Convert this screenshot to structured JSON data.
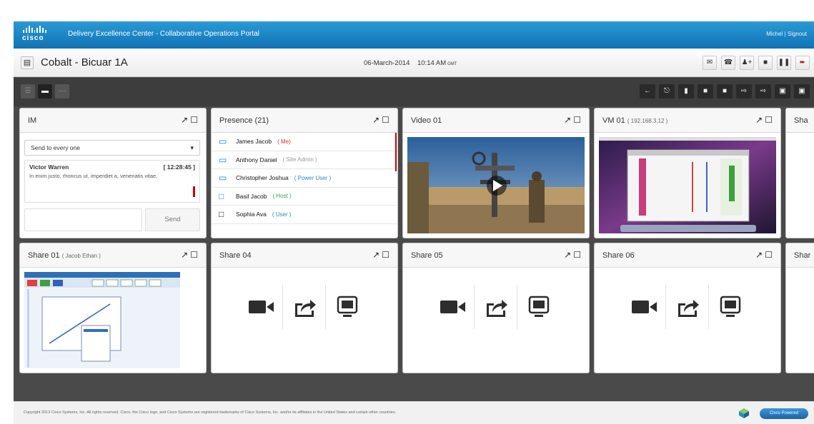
{
  "app": {
    "brand": "cisco",
    "title": "Delivery Excellence Center - Collaborative Operations Portal",
    "user": "Michel | Signout"
  },
  "header": {
    "site_name": "Cobalt - Bicuar 1A",
    "date": "06-March-2014",
    "time": "10:14 AM",
    "ampm": "GMT",
    "buttons": [
      "mail-icon",
      "phone-icon",
      "add-user-icon",
      "stop-icon",
      "pause-icon",
      "exit-icon"
    ]
  },
  "toolbar": {
    "layouts": [
      "layout-1",
      "layout-2",
      "layout-3"
    ],
    "actions": [
      "back-icon",
      "hierarchy-icon",
      "chat-icon",
      "video-icon",
      "video-icon",
      "share-icon",
      "share-icon",
      "screen-icon",
      "screen-icon"
    ]
  },
  "im": {
    "title": "IM",
    "select_value": "Send to every one",
    "message": {
      "sender": "Victor Warren",
      "time": "[ 12:28:45 ]",
      "text": "In enim justo, rhoncus ut, imperdiet a, venenatis vitae,"
    },
    "send_label": "Send"
  },
  "presence": {
    "title": "Presence (21)",
    "users": [
      {
        "name": "James Jacob",
        "role": "( Me)",
        "role_color": "#d0322a",
        "icon": "monitor"
      },
      {
        "name": "Anthony Daniel",
        "role": "( Site Admin )",
        "role_color": "#999999",
        "icon": "monitor"
      },
      {
        "name": "Christopher Joshua",
        "role": "( Power User )",
        "role_color": "#2a8ad2",
        "icon": "monitor"
      },
      {
        "name": "Basil Jacob",
        "role": "( Host )",
        "role_color": "#3aa84a",
        "icon": "square"
      },
      {
        "name": "Sophia Ava",
        "role": "( User )",
        "role_color": "#2a8ad2",
        "icon": "square-dark"
      }
    ]
  },
  "video": {
    "title": "Video 01"
  },
  "vm": {
    "title": "VM 01",
    "ip": "( 192.168.3.12 )"
  },
  "share_top": {
    "title": "Sha"
  },
  "share01": {
    "title": "Share 01",
    "owner": "( Jacob Ethan )"
  },
  "share04": {
    "title": "Share 04"
  },
  "share05": {
    "title": "Share 05"
  },
  "share06": {
    "title": "Share 06"
  },
  "share_bottom": {
    "title": "Shar"
  },
  "footer": {
    "copyright": "Copyright 2013 Cisco Systems, Inc. All rights reserved. Cisco, the Cisco logo, and Cisco Systems are registered trademarks of Cisco Systems, Inc. and/or its affiliates in the United States and certain other countries.",
    "powered": "Cisco Powered"
  },
  "colors": {
    "accent": "#1a7fc4",
    "toolbar": "#3d3d3d",
    "background": "#4a4a4a"
  }
}
